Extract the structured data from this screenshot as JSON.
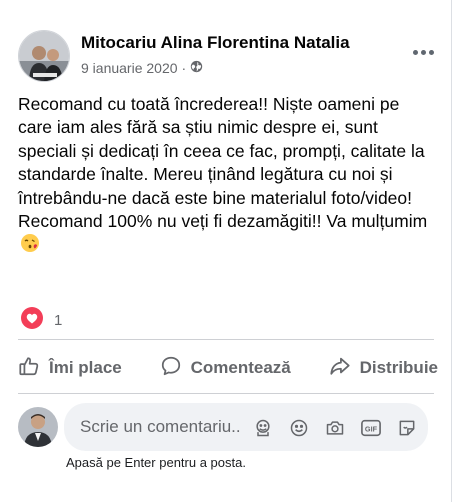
{
  "post": {
    "author": "Mitocariu Alina Florentina Natalia",
    "date": "9 ianuarie 2020",
    "separator": "·",
    "audience_icon": "globe-icon",
    "more_icon": "more-options-icon",
    "body": "Recomand cu toată încrederea!! Niște oameni pe care iam ales fără sa știu nimic despre ei, sunt speciali și dedicați în ceea ce fac, prompți, calitate la standarde înalte. Mereu ținând legătura cu noi și întrebându-ne dacă este bine materialul foto/video! Recomand 100% nu veți fi dezamăgiti!! Va mulțumim",
    "emoji": "face-blowing-kiss-icon"
  },
  "reactions": {
    "icon": "love-reaction-icon",
    "count": "1",
    "color": "#f33e58"
  },
  "actions": {
    "like": "Îmi place",
    "comment": "Comentează",
    "share": "Distribuie"
  },
  "comment_box": {
    "placeholder": "Scrie un comentariu...",
    "icons": [
      "avatar-sticker-icon",
      "emoji-icon",
      "camera-icon",
      "gif-icon",
      "sticker-icon"
    ],
    "hint": "Apasă pe Enter pentru a posta."
  },
  "colors": {
    "text_primary": "#050505",
    "text_secondary": "#65676b",
    "divider": "#ced0d4",
    "input_bg": "#f0f2f5"
  }
}
